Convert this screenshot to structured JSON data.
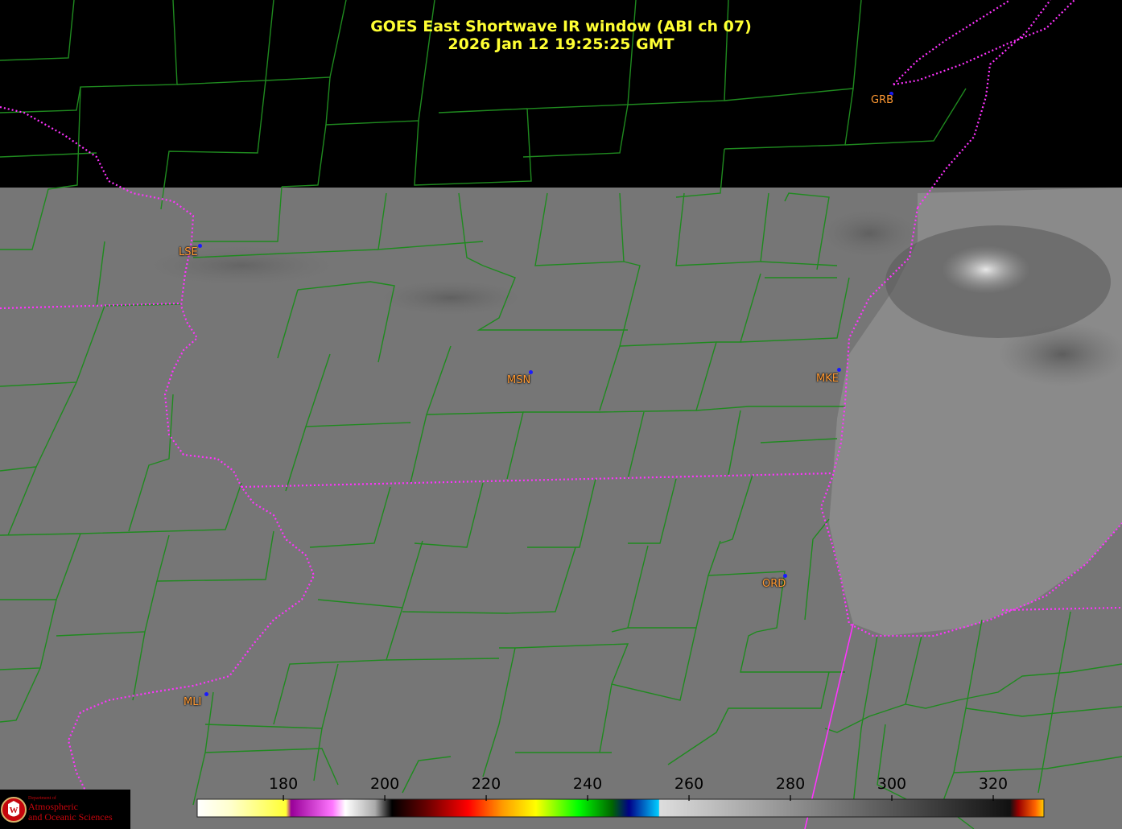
{
  "title": {
    "line1": "GOES East Shortwave IR window (ABI ch 07)",
    "line2": "2026 Jan 12  19:25:25 GMT"
  },
  "stations": [
    {
      "id": "GRB",
      "label": "GRB"
    },
    {
      "id": "LSE",
      "label": "LSE"
    },
    {
      "id": "MSN",
      "label": "MSN"
    },
    {
      "id": "MKE",
      "label": "MKE"
    },
    {
      "id": "ORD",
      "label": "ORD"
    },
    {
      "id": "MLI",
      "label": "MLI"
    }
  ],
  "colorbar": {
    "ticks": [
      "180",
      "200",
      "220",
      "240",
      "260",
      "280",
      "300",
      "320"
    ],
    "unit_range": [
      163,
      330
    ]
  },
  "logo": {
    "department_of": "Department of",
    "line1": "Atmospheric",
    "line2": "and Oceanic Sciences",
    "seal_letter": "W"
  },
  "colors": {
    "title": "#ffff33",
    "county_lines": "#1f8a1f",
    "state_lines": "#ff33ff",
    "station_label": "#ff9933",
    "station_dot": "#1a1aff",
    "logo_red": "#c5050c",
    "land_gray": "#7a7a7a",
    "lake_gray": "#8c8c8c",
    "nodata": "#000000"
  }
}
